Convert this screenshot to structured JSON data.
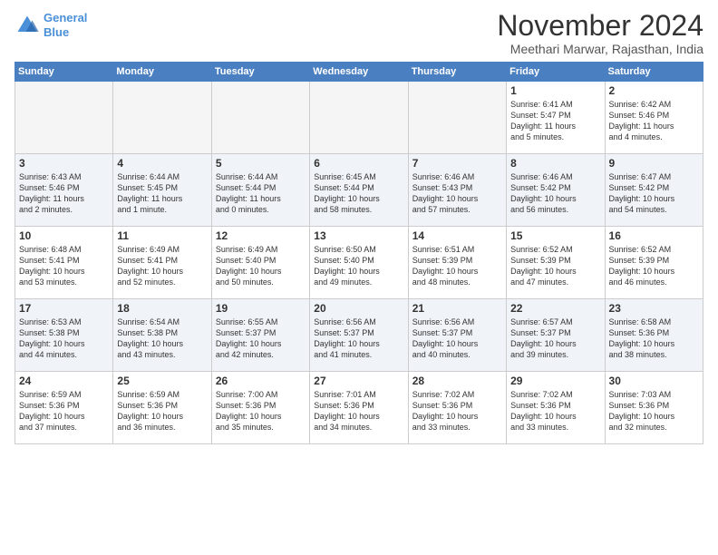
{
  "logo": {
    "line1": "General",
    "line2": "Blue"
  },
  "title": "November 2024",
  "location": "Meethari Marwar, Rajasthan, India",
  "weekdays": [
    "Sunday",
    "Monday",
    "Tuesday",
    "Wednesday",
    "Thursday",
    "Friday",
    "Saturday"
  ],
  "weeks": [
    [
      {
        "day": "",
        "info": ""
      },
      {
        "day": "",
        "info": ""
      },
      {
        "day": "",
        "info": ""
      },
      {
        "day": "",
        "info": ""
      },
      {
        "day": "",
        "info": ""
      },
      {
        "day": "1",
        "info": "Sunrise: 6:41 AM\nSunset: 5:47 PM\nDaylight: 11 hours\nand 5 minutes."
      },
      {
        "day": "2",
        "info": "Sunrise: 6:42 AM\nSunset: 5:46 PM\nDaylight: 11 hours\nand 4 minutes."
      }
    ],
    [
      {
        "day": "3",
        "info": "Sunrise: 6:43 AM\nSunset: 5:46 PM\nDaylight: 11 hours\nand 2 minutes."
      },
      {
        "day": "4",
        "info": "Sunrise: 6:44 AM\nSunset: 5:45 PM\nDaylight: 11 hours\nand 1 minute."
      },
      {
        "day": "5",
        "info": "Sunrise: 6:44 AM\nSunset: 5:44 PM\nDaylight: 11 hours\nand 0 minutes."
      },
      {
        "day": "6",
        "info": "Sunrise: 6:45 AM\nSunset: 5:44 PM\nDaylight: 10 hours\nand 58 minutes."
      },
      {
        "day": "7",
        "info": "Sunrise: 6:46 AM\nSunset: 5:43 PM\nDaylight: 10 hours\nand 57 minutes."
      },
      {
        "day": "8",
        "info": "Sunrise: 6:46 AM\nSunset: 5:42 PM\nDaylight: 10 hours\nand 56 minutes."
      },
      {
        "day": "9",
        "info": "Sunrise: 6:47 AM\nSunset: 5:42 PM\nDaylight: 10 hours\nand 54 minutes."
      }
    ],
    [
      {
        "day": "10",
        "info": "Sunrise: 6:48 AM\nSunset: 5:41 PM\nDaylight: 10 hours\nand 53 minutes."
      },
      {
        "day": "11",
        "info": "Sunrise: 6:49 AM\nSunset: 5:41 PM\nDaylight: 10 hours\nand 52 minutes."
      },
      {
        "day": "12",
        "info": "Sunrise: 6:49 AM\nSunset: 5:40 PM\nDaylight: 10 hours\nand 50 minutes."
      },
      {
        "day": "13",
        "info": "Sunrise: 6:50 AM\nSunset: 5:40 PM\nDaylight: 10 hours\nand 49 minutes."
      },
      {
        "day": "14",
        "info": "Sunrise: 6:51 AM\nSunset: 5:39 PM\nDaylight: 10 hours\nand 48 minutes."
      },
      {
        "day": "15",
        "info": "Sunrise: 6:52 AM\nSunset: 5:39 PM\nDaylight: 10 hours\nand 47 minutes."
      },
      {
        "day": "16",
        "info": "Sunrise: 6:52 AM\nSunset: 5:39 PM\nDaylight: 10 hours\nand 46 minutes."
      }
    ],
    [
      {
        "day": "17",
        "info": "Sunrise: 6:53 AM\nSunset: 5:38 PM\nDaylight: 10 hours\nand 44 minutes."
      },
      {
        "day": "18",
        "info": "Sunrise: 6:54 AM\nSunset: 5:38 PM\nDaylight: 10 hours\nand 43 minutes."
      },
      {
        "day": "19",
        "info": "Sunrise: 6:55 AM\nSunset: 5:37 PM\nDaylight: 10 hours\nand 42 minutes."
      },
      {
        "day": "20",
        "info": "Sunrise: 6:56 AM\nSunset: 5:37 PM\nDaylight: 10 hours\nand 41 minutes."
      },
      {
        "day": "21",
        "info": "Sunrise: 6:56 AM\nSunset: 5:37 PM\nDaylight: 10 hours\nand 40 minutes."
      },
      {
        "day": "22",
        "info": "Sunrise: 6:57 AM\nSunset: 5:37 PM\nDaylight: 10 hours\nand 39 minutes."
      },
      {
        "day": "23",
        "info": "Sunrise: 6:58 AM\nSunset: 5:36 PM\nDaylight: 10 hours\nand 38 minutes."
      }
    ],
    [
      {
        "day": "24",
        "info": "Sunrise: 6:59 AM\nSunset: 5:36 PM\nDaylight: 10 hours\nand 37 minutes."
      },
      {
        "day": "25",
        "info": "Sunrise: 6:59 AM\nSunset: 5:36 PM\nDaylight: 10 hours\nand 36 minutes."
      },
      {
        "day": "26",
        "info": "Sunrise: 7:00 AM\nSunset: 5:36 PM\nDaylight: 10 hours\nand 35 minutes."
      },
      {
        "day": "27",
        "info": "Sunrise: 7:01 AM\nSunset: 5:36 PM\nDaylight: 10 hours\nand 34 minutes."
      },
      {
        "day": "28",
        "info": "Sunrise: 7:02 AM\nSunset: 5:36 PM\nDaylight: 10 hours\nand 33 minutes."
      },
      {
        "day": "29",
        "info": "Sunrise: 7:02 AM\nSunset: 5:36 PM\nDaylight: 10 hours\nand 33 minutes."
      },
      {
        "day": "30",
        "info": "Sunrise: 7:03 AM\nSunset: 5:36 PM\nDaylight: 10 hours\nand 32 minutes."
      }
    ]
  ]
}
